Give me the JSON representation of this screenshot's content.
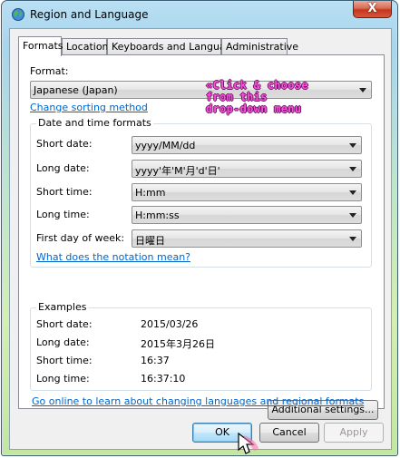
{
  "window": {
    "title": "Region and Language",
    "close_label": "X"
  },
  "tabs": [
    {
      "label": "Formats",
      "active": true
    },
    {
      "label": "Location",
      "active": false
    },
    {
      "label": "Keyboards and Languages",
      "active": false
    },
    {
      "label": "Administrative",
      "active": false
    }
  ],
  "format": {
    "label": "Format:",
    "value": "Japanese (Japan)",
    "change_sorting_link": "Change sorting method"
  },
  "annotation": {
    "lines": [
      "«Click & choose",
      "from this",
      "drop-down menu"
    ],
    "color": "#ff4fe1"
  },
  "date_time": {
    "group_title": "Date and time formats",
    "short_date": {
      "label": "Short date:",
      "value": "yyyy/MM/dd"
    },
    "long_date": {
      "label": "Long date:",
      "value": "yyyy'年'M'月'd'日'"
    },
    "short_time": {
      "label": "Short time:",
      "value": "H:mm"
    },
    "long_time": {
      "label": "Long time:",
      "value": "H:mm:ss"
    },
    "first_day": {
      "label": "First day of week:",
      "value": "日曜日"
    },
    "notation_link": "What does the notation mean?"
  },
  "examples": {
    "group_title": "Examples",
    "short_date": {
      "label": "Short date:",
      "value": "2015/03/26"
    },
    "long_date": {
      "label": "Long date:",
      "value": "2015年3月26日"
    },
    "short_time": {
      "label": "Short time:",
      "value": "16:37"
    },
    "long_time": {
      "label": "Long time:",
      "value": "16:37:10"
    }
  },
  "additional_settings_label": "Additional settings...",
  "online_link": "Go online to learn about changing languages and regional formats",
  "buttons": {
    "ok": "OK",
    "cancel": "Cancel",
    "apply": "Apply"
  },
  "icons": {
    "title_icon": "globe-icon",
    "cursor": "hand-pointer-icon"
  }
}
